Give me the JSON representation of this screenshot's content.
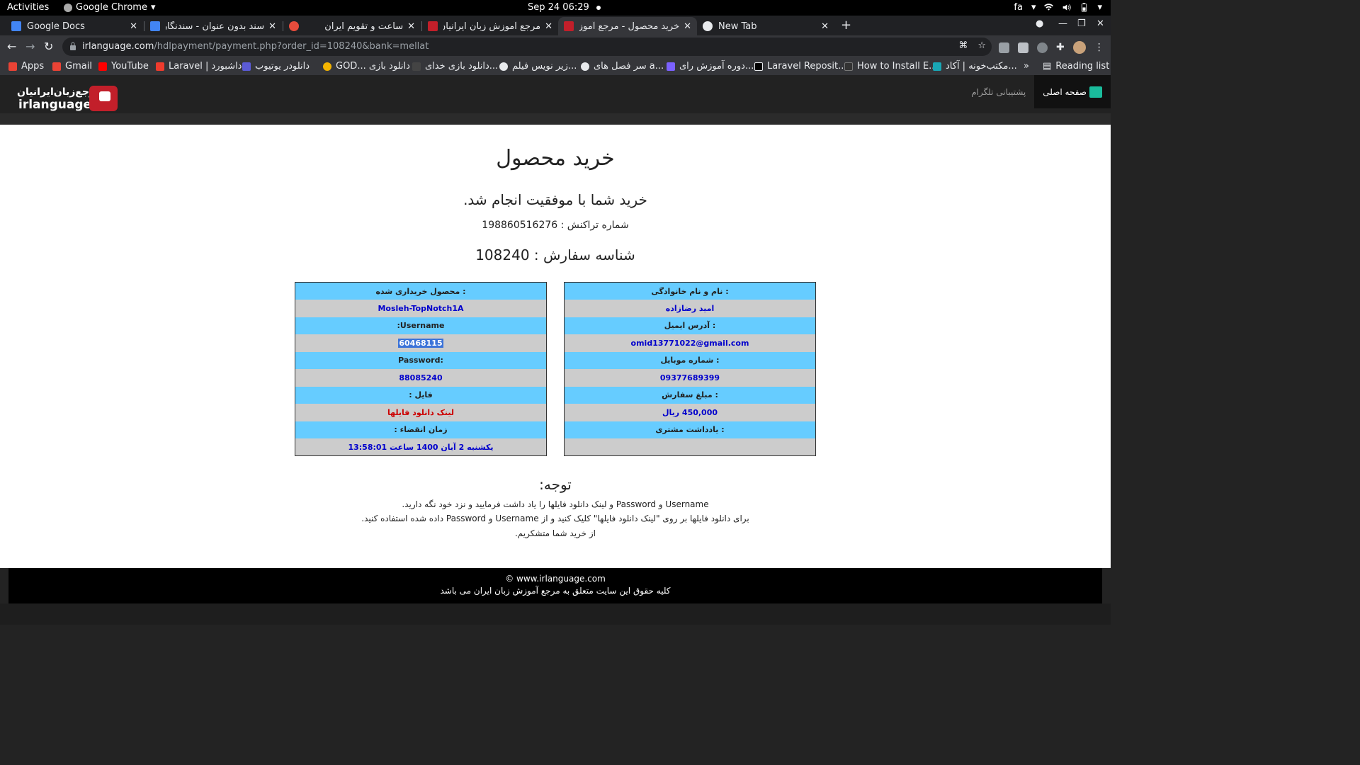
{
  "system_bar": {
    "activities": "Activities",
    "app_name": "Google Chrome",
    "clock": "Sep 24  06:29",
    "lang": "fa"
  },
  "tabs": [
    {
      "title": "Google Docs",
      "favicon_color": "#4285f4",
      "active": false
    },
    {
      "title": "سند بدون عنوان - سندنگار",
      "favicon_color": "#4285f4",
      "active": false
    },
    {
      "title": "ساعت و تقویم ایران",
      "favicon_color": "#e74c3c",
      "active": false
    },
    {
      "title": "مرجع آموزش زبان ایرانیان -",
      "favicon_color": "#c21f2a",
      "active": false
    },
    {
      "title": "خرید محصول - مرجع آموزش",
      "favicon_color": "#c21f2a",
      "active": true
    },
    {
      "title": "New Tab",
      "favicon_color": "#e8eaed",
      "active": false
    }
  ],
  "omnibox": {
    "domain": "irlanguage.com",
    "path": "/hdlpayment/payment.php?order_id=108240&bank=mellat"
  },
  "bookmarks": [
    {
      "label": "Apps",
      "icon": "apps-grid-icon",
      "color": "#ea4335"
    },
    {
      "label": "Gmail",
      "icon": "gmail-icon",
      "color": "#ea4335"
    },
    {
      "label": "YouTube",
      "icon": "youtube-icon",
      "color": "#ff0000"
    },
    {
      "label": "Laravel | داشبورد",
      "icon": "laravel-icon",
      "color": "#ef3b2d"
    },
    {
      "label": "دانلودر یوتیوب",
      "icon": "downloader-icon",
      "color": "#5b5bd6"
    },
    {
      "label": "GOD... دانلود بازی",
      "icon": "god-icon",
      "color": "#f4b400"
    },
    {
      "label": "دانلود بازی خدای...",
      "icon": "game-icon",
      "color": "#444444"
    },
    {
      "label": "زیر نویس فیلم...",
      "icon": "subtitle-icon",
      "color": "#e8eaed"
    },
    {
      "label": "سر فصل های a...",
      "icon": "chapters-icon",
      "color": "#e8eaed"
    },
    {
      "label": "دوره آموزش رای...",
      "icon": "course-icon",
      "color": "#7b61ff"
    },
    {
      "label": "Laravel Reposit...",
      "icon": "dev-icon",
      "color": "#000000"
    },
    {
      "label": "How to Install E...",
      "icon": "install-icon",
      "color": "#333333"
    },
    {
      "label": "مکتب‌خونه | آکاد...",
      "icon": "maktabkhooneh-icon",
      "color": "#19a7b5"
    }
  ],
  "reading_list": "Reading list",
  "site": {
    "logo_fa": "مرجع‌زبان‌ایرانیان",
    "logo_en": "irlanguage",
    "nav_home": "صفحه اصلی",
    "nav_support": "پشتیبانی تلگرام"
  },
  "page": {
    "title": "خرید محصول",
    "success": "خرید شما با موفقیت انجام شد.",
    "transaction": "شماره تراکنش : 198860516276",
    "order": "شناسه سفارش : 108240"
  },
  "customer_table": [
    {
      "label": ": نام و نام خانوادگی",
      "value": "امید رضازاده"
    },
    {
      "label": ": آدرس ایمیل",
      "value": "omid13771022@gmail.com"
    },
    {
      "label": ": شماره موبایل",
      "value": "09377689399"
    },
    {
      "label": ": مبلغ سفارش",
      "value": "450,000 ریال"
    },
    {
      "label": ": یادداشت مشتری",
      "value": ""
    }
  ],
  "product_table": [
    {
      "label": ": محصول خریداری شده",
      "value": "Mosleh-TopNotch1A"
    },
    {
      "label": "Username:",
      "value": "60468115"
    },
    {
      "label": ":Password",
      "value": "88085240"
    },
    {
      "label": "فایل :",
      "value": "لینک دانلود فایلها"
    },
    {
      "label": "زمان انقضاء :",
      "value": "یکشنبه 2 آبان 1400 ساعت 13:58:01"
    }
  ],
  "note": {
    "title": "توجه:",
    "line1": "Username و Password و لینک دانلود فایلها را یاد داشت فرمایید و نزد خود نگه دارید.",
    "line2": "برای دانلود فایلها بر روی \"لینک دانلود فایلها\" کلیک کنید و از Username و Password داده شده استفاده کنید.",
    "line3": "از خرید شما متشکریم."
  },
  "footer": {
    "copyright": "© www.irlanguage.com",
    "rights": "کلیه حقوق این سایت متعلق به مرجع آموزش زبان ایران می باشد"
  }
}
